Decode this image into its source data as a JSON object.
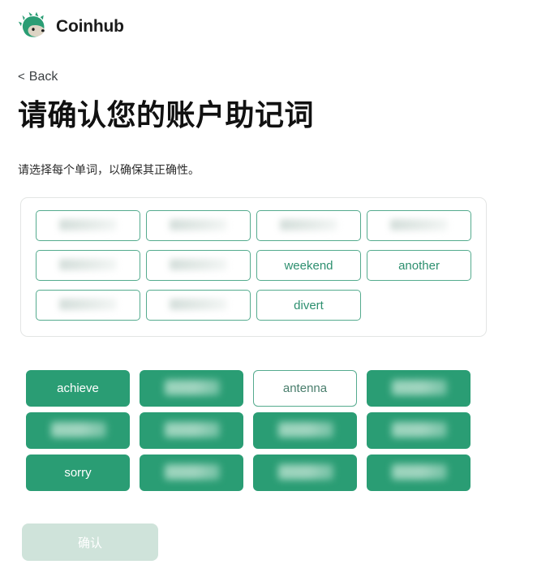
{
  "brand": {
    "name": "Coinhub",
    "logo_icon": "hedgehog-logo-icon",
    "logo_color": "#2a9d74"
  },
  "nav": {
    "back_label": "Back",
    "back_chevron": "<"
  },
  "header": {
    "title": "请确认您的账户助记词",
    "subtitle": "请选择每个单词，以确保其正确性。"
  },
  "theme": {
    "accent": "#2a9d74",
    "slot_border": "#55ab8e",
    "slot_text": "#2d8f6f",
    "disabled_button": "#cfe3da",
    "panel_border": "#e3e5e4"
  },
  "mnemonic_slots": [
    {
      "index": 1,
      "word": "",
      "redacted": true
    },
    {
      "index": 2,
      "word": "",
      "redacted": true
    },
    {
      "index": 3,
      "word": "",
      "redacted": true
    },
    {
      "index": 4,
      "word": "",
      "redacted": true
    },
    {
      "index": 5,
      "word": "",
      "redacted": true
    },
    {
      "index": 6,
      "word": "",
      "redacted": true
    },
    {
      "index": 7,
      "word": "weekend",
      "redacted": false
    },
    {
      "index": 8,
      "word": "another",
      "redacted": false
    },
    {
      "index": 9,
      "word": "",
      "redacted": true
    },
    {
      "index": 10,
      "word": "",
      "redacted": true
    },
    {
      "index": 11,
      "word": "divert",
      "redacted": false
    }
  ],
  "word_bank": [
    {
      "index": 1,
      "word": "achieve",
      "state": "used",
      "redacted": false
    },
    {
      "index": 2,
      "word": "",
      "state": "used",
      "redacted": true
    },
    {
      "index": 3,
      "word": "antenna",
      "state": "available",
      "redacted": false
    },
    {
      "index": 4,
      "word": "",
      "state": "used",
      "redacted": true
    },
    {
      "index": 5,
      "word": "",
      "state": "used",
      "redacted": true
    },
    {
      "index": 6,
      "word": "",
      "state": "used",
      "redacted": true
    },
    {
      "index": 7,
      "word": "",
      "state": "used",
      "redacted": true
    },
    {
      "index": 8,
      "word": "",
      "state": "used",
      "redacted": true
    },
    {
      "index": 9,
      "word": "sorry",
      "state": "used",
      "redacted": false
    },
    {
      "index": 10,
      "word": "",
      "state": "used",
      "redacted": true
    },
    {
      "index": 11,
      "word": "",
      "state": "used",
      "redacted": true
    },
    {
      "index": 12,
      "word": "",
      "state": "used",
      "redacted": true
    }
  ],
  "footer": {
    "confirm_label": "确认",
    "confirm_enabled": false
  }
}
